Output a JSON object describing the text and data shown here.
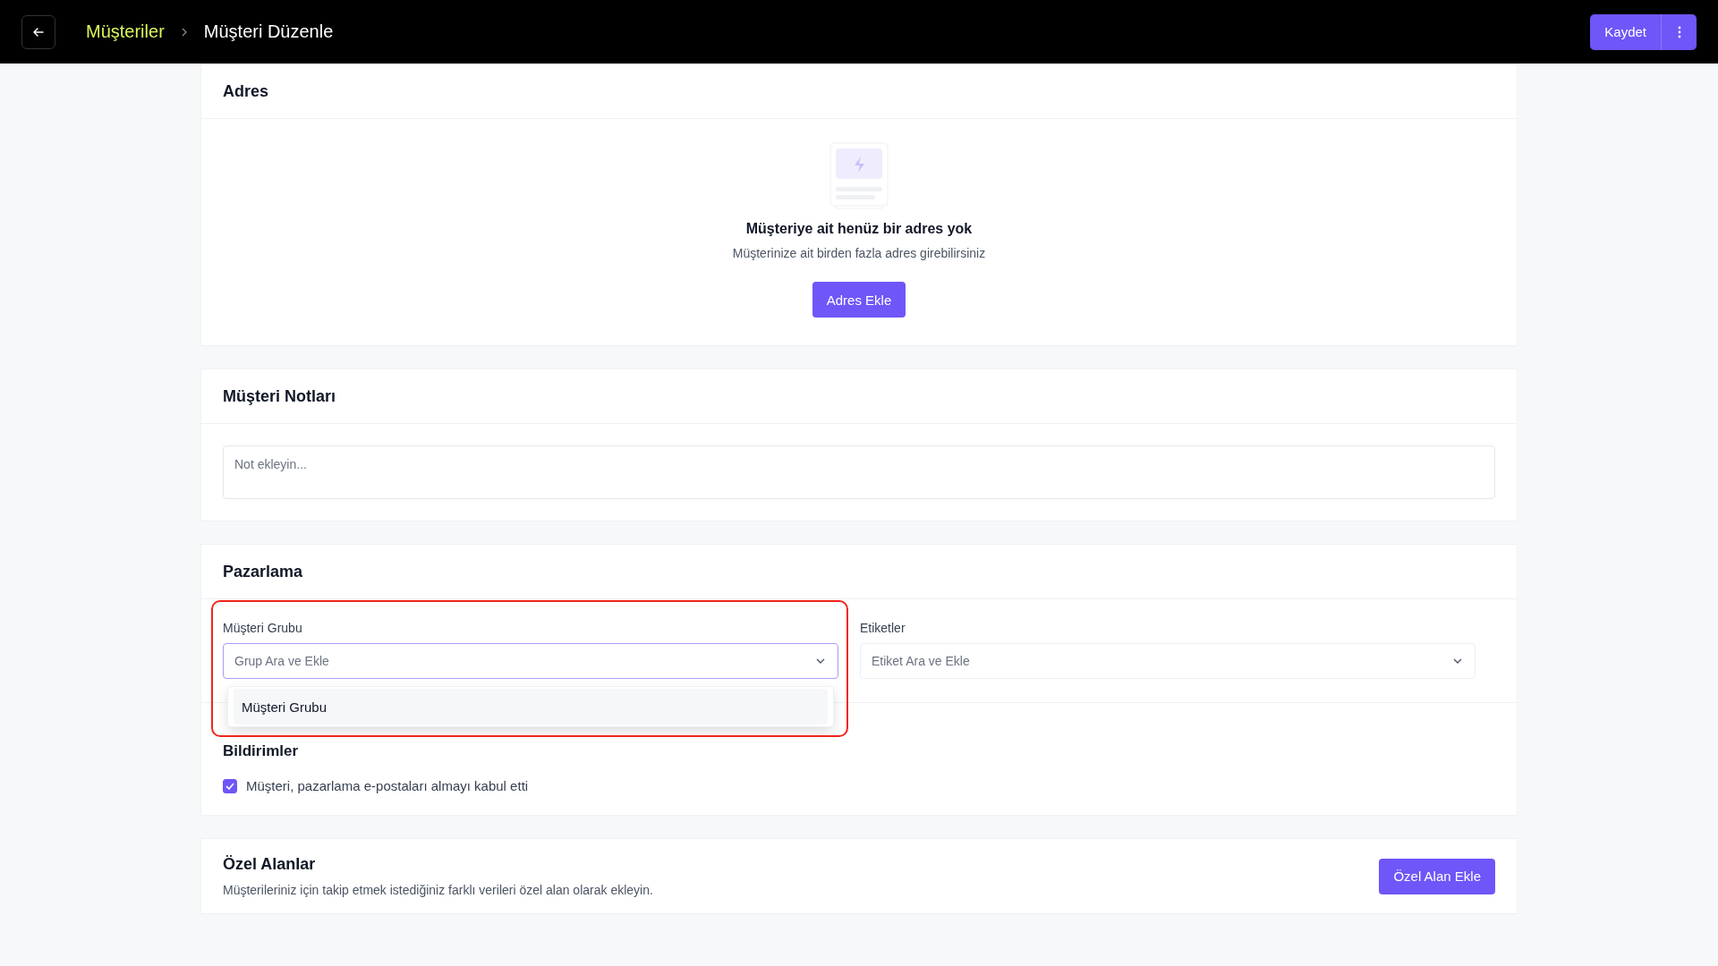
{
  "header": {
    "breadcrumb": [
      {
        "label": "Müşteriler",
        "kind": "link"
      },
      {
        "label": "Müşteri Düzenle",
        "kind": "current"
      }
    ],
    "save_button": "Kaydet"
  },
  "address": {
    "title": "Adres",
    "empty_title": "Müşteriye ait henüz bir adres yok",
    "empty_text": "Müşterinize ait birden fazla adres girebilirsiniz",
    "button": "Adres Ekle"
  },
  "notes": {
    "title": "Müşteri Notları",
    "placeholder": "Not ekleyin..."
  },
  "marketing": {
    "title": "Pazarlama",
    "fields": [
      {
        "label": "Müşteri Grubu",
        "placeholder": "Grup Ara ve Ekle",
        "focused": true,
        "highlighted": true,
        "options": [
          "Müşteri Grubu"
        ]
      },
      {
        "label": "Etiketler",
        "placeholder": "Etiket Ara ve Ekle",
        "focused": false
      }
    ],
    "notifications": {
      "title": "Bildirimler",
      "consent": {
        "label": "Müşteri, pazarlama e-postaları almayı kabul etti",
        "checked": true
      }
    }
  },
  "custom_fields": {
    "title": "Özel Alanlar",
    "description": "Müşterileriniz için takip etmek istediğiniz farklı verileri özel alan olarak ekleyin.",
    "button": "Özel Alan Ekle"
  }
}
